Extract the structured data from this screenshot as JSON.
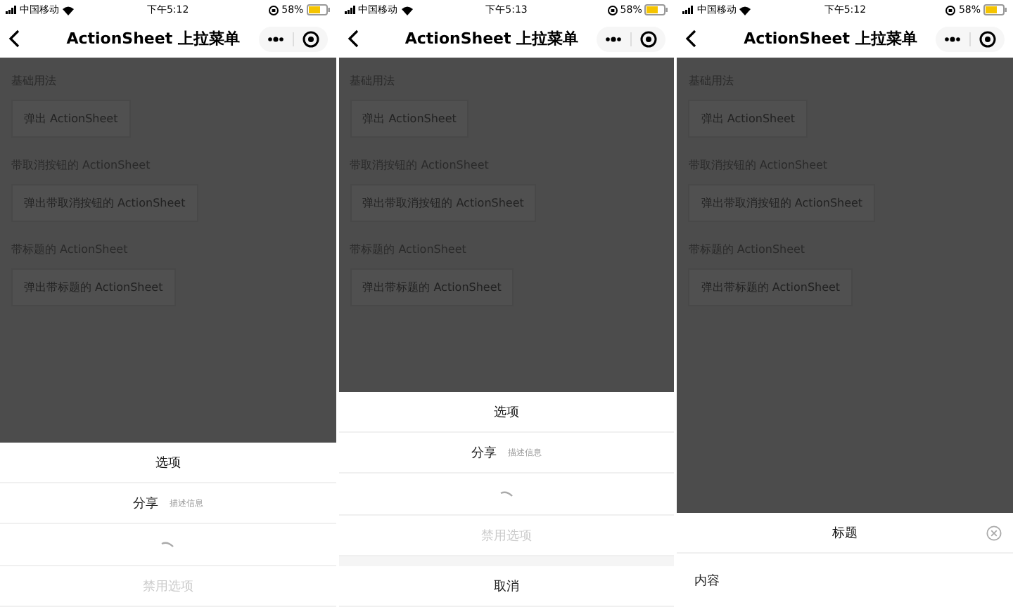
{
  "phones": [
    {
      "status": {
        "carrier": "中国移动",
        "time": "下午5:12",
        "battery": "58%"
      },
      "nav": {
        "title": "ActionSheet 上拉菜单"
      },
      "sections": [
        {
          "heading": "基础用法",
          "button": "弹出 ActionSheet"
        },
        {
          "heading": "带取消按钮的 ActionSheet",
          "button": "弹出带取消按钮的 ActionSheet"
        },
        {
          "heading": "带标题的 ActionSheet",
          "button": "弹出带标题的 ActionSheet"
        }
      ],
      "sheet": {
        "kind": "menu",
        "title": "选项",
        "items": [
          {
            "kind": "text",
            "label": "分享",
            "description": "描述信息",
            "disabled": false
          },
          {
            "kind": "loading"
          },
          {
            "kind": "text",
            "label": "禁用选项",
            "disabled": true
          }
        ]
      }
    },
    {
      "status": {
        "carrier": "中国移动",
        "time": "下午5:13",
        "battery": "58%"
      },
      "nav": {
        "title": "ActionSheet 上拉菜单"
      },
      "sections": [
        {
          "heading": "基础用法",
          "button": "弹出 ActionSheet"
        },
        {
          "heading": "带取消按钮的 ActionSheet",
          "button": "弹出带取消按钮的 ActionSheet"
        },
        {
          "heading": "带标题的 ActionSheet",
          "button": "弹出带标题的 ActionSheet"
        }
      ],
      "sheet": {
        "kind": "menu",
        "title": "选项",
        "items": [
          {
            "kind": "text",
            "label": "分享",
            "description": "描述信息",
            "disabled": false
          },
          {
            "kind": "loading"
          },
          {
            "kind": "text",
            "label": "禁用选项",
            "disabled": true
          }
        ],
        "cancel": "取消"
      }
    },
    {
      "status": {
        "carrier": "中国移动",
        "time": "下午5:12",
        "battery": "58%"
      },
      "nav": {
        "title": "ActionSheet 上拉菜单"
      },
      "sections": [
        {
          "heading": "基础用法",
          "button": "弹出 ActionSheet"
        },
        {
          "heading": "带取消按钮的 ActionSheet",
          "button": "弹出带取消按钮的 ActionSheet"
        },
        {
          "heading": "带标题的 ActionSheet",
          "button": "弹出带标题的 ActionSheet"
        }
      ],
      "sheet": {
        "kind": "dialog",
        "title": "标题",
        "content": "内容"
      }
    }
  ]
}
